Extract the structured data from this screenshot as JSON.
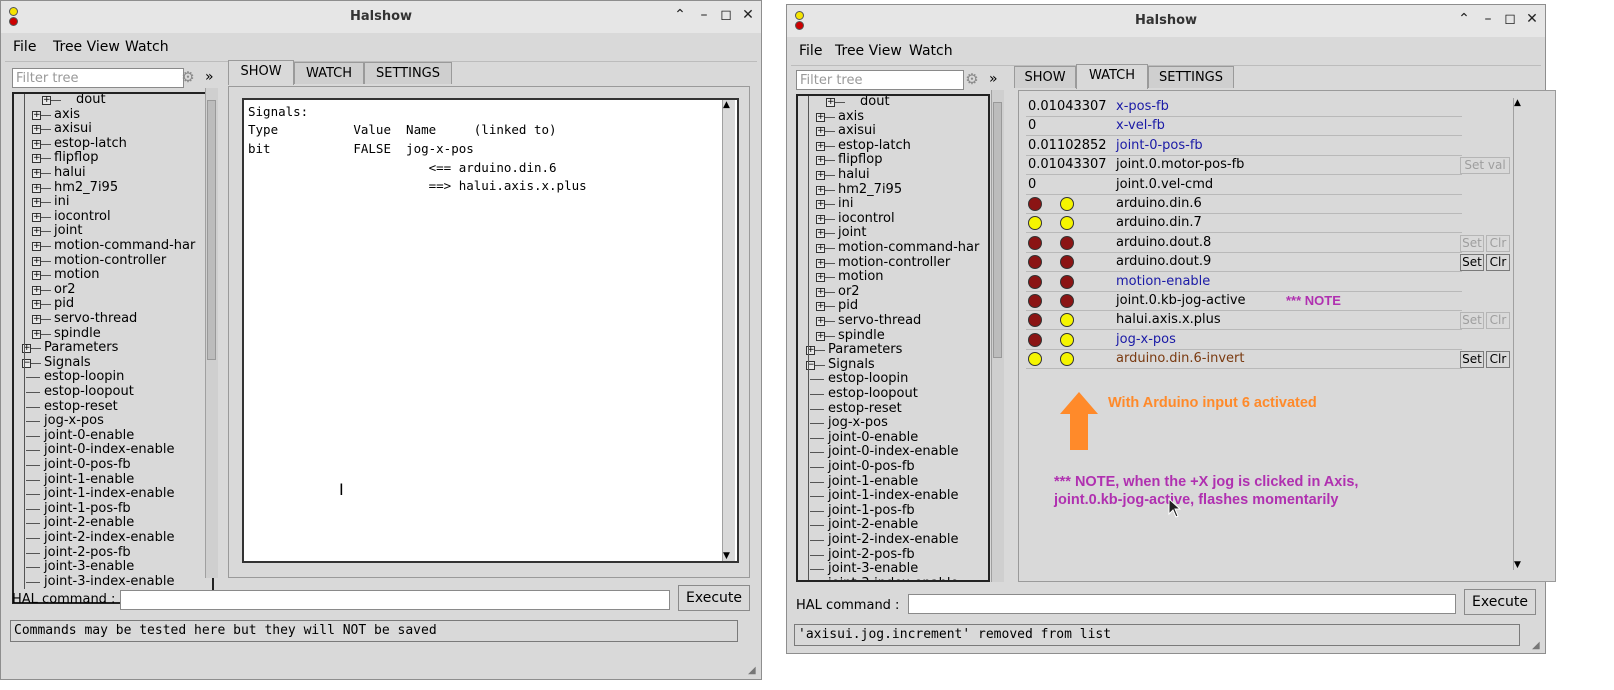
{
  "colors": {
    "link": "#1a1aa6",
    "brown": "#7a3a10",
    "led_red": "#8b1414",
    "led_yellow": "#f5f500",
    "orange": "#ff8a2a",
    "purple": "#b030b0"
  },
  "left_window": {
    "title": "Halshow",
    "menu": [
      "File",
      "Tree View",
      "Watch"
    ],
    "filter_placeholder": "Filter tree",
    "chevron": "»",
    "tabs": [
      "SHOW",
      "WATCH",
      "SETTINGS"
    ],
    "active_tab": "SHOW",
    "tree": {
      "top_item": "dout",
      "pins": [
        "axis",
        "axisui",
        "estop-latch",
        "flipflop",
        "halui",
        "hm2_7i95",
        "ini",
        "iocontrol",
        "joint",
        "motion-command-har",
        "motion-controller",
        "motion",
        "or2",
        "pid",
        "servo-thread",
        "spindle"
      ],
      "parameters": "Parameters",
      "signals": "Signals",
      "signal_items": [
        "estop-loopin",
        "estop-loopout",
        "estop-reset",
        "jog-x-pos",
        "joint-0-enable",
        "joint-0-index-enable",
        "joint-0-pos-fb",
        "joint-1-enable",
        "joint-1-index-enable",
        "joint-1-pos-fb",
        "joint-2-enable",
        "joint-2-index-enable",
        "joint-2-pos-fb",
        "joint-3-enable",
        "joint-3-index-enable"
      ]
    },
    "show_lines": [
      "Signals:",
      "Type          Value  Name     (linked to)",
      "bit           FALSE  jog-x-pos",
      "                        <== arduino.din.6",
      "                        ==> halui.axis.x.plus"
    ],
    "hal_label": "HAL command :",
    "execute": "Execute",
    "status": "Commands may be tested here but they will NOT be saved"
  },
  "right_window": {
    "title": "Halshow",
    "menu": [
      "File",
      "Tree View",
      "Watch"
    ],
    "filter_placeholder": "Filter tree",
    "chevron": "»",
    "tabs": [
      "SHOW",
      "WATCH",
      "SETTINGS"
    ],
    "active_tab": "WATCH",
    "watch_rows": [
      {
        "value": "0.01043307",
        "name": "x-pos-fb",
        "color": "link"
      },
      {
        "value": "0",
        "name": "x-vel-fb",
        "color": "link"
      },
      {
        "value": "0.01102852",
        "name": "joint-0-pos-fb",
        "color": "link"
      },
      {
        "value": "0.01043307",
        "name": "joint.0.motor-pos-fb",
        "color": "black",
        "button": "Set val",
        "button_enabled": false
      },
      {
        "value": "0",
        "name": "joint.0.vel-cmd",
        "color": "black"
      },
      {
        "leds": [
          "red",
          "yellow"
        ],
        "name": "arduino.din.6",
        "color": "black"
      },
      {
        "leds": [
          "yellow",
          "yellow"
        ],
        "name": "arduino.din.7",
        "color": "black"
      },
      {
        "leds": [
          "red",
          "red"
        ],
        "name": "arduino.dout.8",
        "color": "black",
        "setclr": true,
        "setclr_enabled": false
      },
      {
        "leds": [
          "red",
          "red"
        ],
        "name": "arduino.dout.9",
        "color": "black",
        "setclr": true,
        "setclr_enabled": true
      },
      {
        "leds": [
          "red",
          "red"
        ],
        "name": "motion-enable",
        "color": "link"
      },
      {
        "leds": [
          "red",
          "red"
        ],
        "name": "joint.0.kb-jog-active",
        "color": "black",
        "note": "*** NOTE"
      },
      {
        "leds": [
          "red",
          "yellow"
        ],
        "name": "halui.axis.x.plus",
        "color": "black",
        "setclr": true,
        "setclr_enabled": false
      },
      {
        "leds": [
          "red",
          "yellow"
        ],
        "name": "jog-x-pos",
        "color": "link"
      },
      {
        "leds": [
          "yellow",
          "yellow"
        ],
        "name": "arduino.din.6-invert",
        "color": "brown",
        "setclr": true,
        "setclr_enabled": true
      }
    ],
    "set_label": "Set",
    "clr_label": "Clr",
    "annotation_orange": "With Arduino input 6 activated",
    "annotation_purple_1": "*** NOTE, when the +X jog is clicked in Axis,",
    "annotation_purple_2": "joint.0.kb-jog-active, flashes momentarily",
    "hal_label": "HAL command :",
    "execute": "Execute",
    "status": "'axisui.jog.increment' removed from list"
  }
}
